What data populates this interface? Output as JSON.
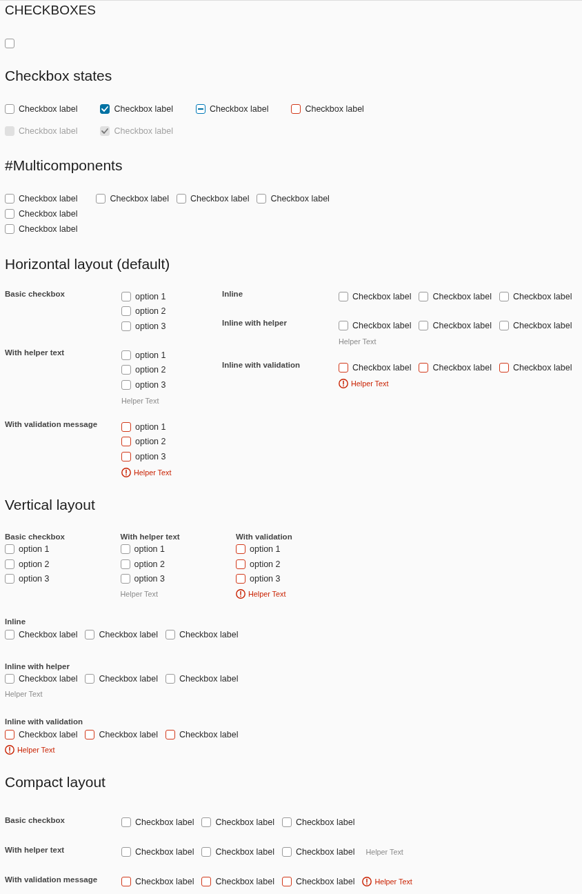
{
  "title": "CHECKBOXES",
  "single": {
    "checked": false
  },
  "states": {
    "heading": "Checkbox states",
    "rows": [
      [
        {
          "label": "Checkbox label",
          "kind": "plain",
          "checked": false,
          "indeterminate": false,
          "disabled": false
        },
        {
          "label": "Checkbox label",
          "kind": "plain",
          "checked": true,
          "indeterminate": false,
          "disabled": false
        },
        {
          "label": "Checkbox label",
          "kind": "plain",
          "checked": false,
          "indeterminate": true,
          "disabled": false
        },
        {
          "label": "Checkbox label",
          "kind": "error",
          "checked": false,
          "indeterminate": false,
          "disabled": false
        }
      ],
      [
        {
          "label": "Checkbox label",
          "kind": "plain",
          "checked": false,
          "indeterminate": false,
          "disabled": true
        },
        {
          "label": "Checkbox label",
          "kind": "plain",
          "checked": true,
          "indeterminate": false,
          "disabled": true
        }
      ]
    ]
  },
  "multicomponents": {
    "heading": "#Multicomponents",
    "groups": [
      {
        "kind": "vertical",
        "options": [
          {
            "label": "Checkbox label",
            "checked": false
          },
          {
            "label": "Checkbox label",
            "checked": false
          },
          {
            "label": "Checkbox label",
            "checked": false
          }
        ]
      },
      {
        "kind": "inline",
        "options": [
          {
            "label": "Checkbox label",
            "checked": false
          },
          {
            "label": "Checkbox label",
            "checked": false
          },
          {
            "label": "Checkbox label",
            "checked": false
          }
        ]
      }
    ]
  },
  "horizontal": {
    "heading": "Horizontal layout (default)",
    "columns": [
      [
        {
          "label": "Basic checkbox",
          "kind": "vertical",
          "invalid": false,
          "options": [
            {
              "label": "option 1",
              "checked": false
            },
            {
              "label": "option 2",
              "checked": false
            },
            {
              "label": "option 3",
              "checked": false
            }
          ]
        },
        {
          "label": "With helper text",
          "kind": "vertical",
          "invalid": false,
          "options": [
            {
              "label": "option 1",
              "checked": false
            },
            {
              "label": "option 2",
              "checked": false
            },
            {
              "label": "option 3",
              "checked": false
            }
          ],
          "helper": "Helper Text"
        },
        {
          "label": "With validation message",
          "kind": "vertical",
          "invalid": true,
          "options": [
            {
              "label": "option 1",
              "checked": false
            },
            {
              "label": "option 2",
              "checked": false
            },
            {
              "label": "option 3",
              "checked": false
            }
          ],
          "helper": "Helper Text"
        }
      ],
      [
        {
          "label": "Inline",
          "kind": "inline",
          "invalid": false,
          "options": [
            {
              "label": "Checkbox label",
              "checked": false
            },
            {
              "label": "Checkbox label",
              "checked": false
            },
            {
              "label": "Checkbox label",
              "checked": false
            }
          ]
        },
        {
          "label": "Inline with helper",
          "kind": "inline",
          "invalid": false,
          "options": [
            {
              "label": "Checkbox label",
              "checked": false
            },
            {
              "label": "Checkbox label",
              "checked": false
            },
            {
              "label": "Checkbox label",
              "checked": false
            }
          ],
          "helper": "Helper Text"
        },
        {
          "label": "Inline with validation",
          "kind": "inline",
          "invalid": true,
          "options": [
            {
              "label": "Checkbox label",
              "checked": false
            },
            {
              "label": "Checkbox label",
              "checked": false
            },
            {
              "label": "Checkbox label",
              "checked": false
            }
          ],
          "helper": "Helper Text"
        }
      ]
    ]
  },
  "vertical": {
    "heading": "Vertical layout",
    "columns": [
      {
        "label": "Basic checkbox",
        "kind": "vertical",
        "invalid": false,
        "options": [
          {
            "label": "option 1",
            "checked": false
          },
          {
            "label": "option 2",
            "checked": false
          },
          {
            "label": "option 3",
            "checked": false
          }
        ]
      },
      {
        "label": "With helper text",
        "kind": "vertical",
        "invalid": false,
        "options": [
          {
            "label": "option 1",
            "checked": false
          },
          {
            "label": "option 2",
            "checked": false
          },
          {
            "label": "option 3",
            "checked": false
          }
        ],
        "helper": "Helper Text"
      },
      {
        "label": "With validation",
        "kind": "vertical",
        "invalid": true,
        "options": [
          {
            "label": "option 1",
            "checked": false
          },
          {
            "label": "option 2",
            "checked": false
          },
          {
            "label": "option 3",
            "checked": false
          }
        ],
        "helper": "Helper Text"
      }
    ],
    "inline_groups": [
      {
        "label": "Inline",
        "kind": "inline",
        "invalid": false,
        "options": [
          {
            "label": "Checkbox label",
            "checked": false
          },
          {
            "label": "Checkbox label",
            "checked": false
          },
          {
            "label": "Checkbox label",
            "checked": false
          }
        ]
      },
      {
        "label": "Inline with helper",
        "kind": "inline",
        "invalid": false,
        "options": [
          {
            "label": "Checkbox label",
            "checked": false
          },
          {
            "label": "Checkbox label",
            "checked": false
          },
          {
            "label": "Checkbox label",
            "checked": false
          }
        ],
        "helper": "Helper Text"
      },
      {
        "label": "Inline with validation",
        "kind": "inline",
        "invalid": true,
        "options": [
          {
            "label": "Checkbox label",
            "checked": false
          },
          {
            "label": "Checkbox label",
            "checked": false
          },
          {
            "label": "Checkbox label",
            "checked": false
          }
        ],
        "helper": "Helper Text"
      }
    ]
  },
  "compact": {
    "heading": "Compact layout",
    "groups": [
      {
        "label": "Basic checkbox",
        "kind": "inline",
        "invalid": false,
        "options": [
          {
            "label": "Checkbox label",
            "checked": false
          },
          {
            "label": "Checkbox label",
            "checked": false
          },
          {
            "label": "Checkbox label",
            "checked": false
          }
        ]
      },
      {
        "label": "With helper text",
        "kind": "inline",
        "invalid": false,
        "options": [
          {
            "label": "Checkbox label",
            "checked": false
          },
          {
            "label": "Checkbox label",
            "checked": false
          },
          {
            "label": "Checkbox label",
            "checked": false
          }
        ],
        "helper": "Helper Text"
      },
      {
        "label": "With validation message",
        "kind": "inline",
        "invalid": true,
        "options": [
          {
            "label": "Checkbox label",
            "checked": false
          },
          {
            "label": "Checkbox label",
            "checked": false
          },
          {
            "label": "Checkbox label",
            "checked": false
          }
        ],
        "helper": "Helper Text"
      }
    ]
  }
}
